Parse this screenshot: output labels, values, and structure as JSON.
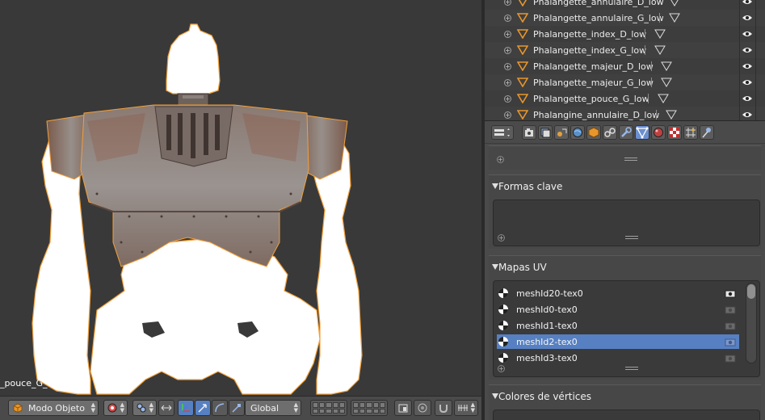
{
  "viewport": {
    "object_label": "_pouce_G_"
  },
  "view_header": {
    "mode_label": "Modo Objeto",
    "orientation_label": "Global"
  },
  "outliner": {
    "items": [
      {
        "name": "Phalangette_annulaire_D_low"
      },
      {
        "name": "Phalangette_annulaire_G_low"
      },
      {
        "name": "Phalangette_index_D_low"
      },
      {
        "name": "Phalangette_index_G_low"
      },
      {
        "name": "Phalangette_majeur_D_low"
      },
      {
        "name": "Phalangette_majeur_G_low"
      },
      {
        "name": "Phalangette_pouce_G_low"
      },
      {
        "name": "Phalangine_annulaire_D_low"
      }
    ]
  },
  "properties": {
    "tabs": [
      "render",
      "render-layers",
      "scene",
      "world",
      "object",
      "constraints",
      "modifiers",
      "data",
      "material",
      "texture",
      "particles",
      "physics"
    ],
    "active_tab": "data",
    "panels": {
      "shape_keys": {
        "title": "Formas clave"
      },
      "uv_maps": {
        "title": "Mapas UV",
        "items": [
          {
            "name": "meshId20-tex0",
            "selected": false,
            "active_render": true
          },
          {
            "name": "meshId0-tex0",
            "selected": false,
            "active_render": false
          },
          {
            "name": "meshId1-tex0",
            "selected": false,
            "active_render": false
          },
          {
            "name": "meshId2-tex0",
            "selected": true,
            "active_render": false
          },
          {
            "name": "meshId3-tex0",
            "selected": false,
            "active_render": false
          }
        ]
      },
      "vertex_colors": {
        "title": "Colores de vértices"
      }
    }
  },
  "colors": {
    "accent_selected": "#5680c2",
    "mesh_orange": "#e8962a",
    "selection_outline": "#f2a03a"
  }
}
